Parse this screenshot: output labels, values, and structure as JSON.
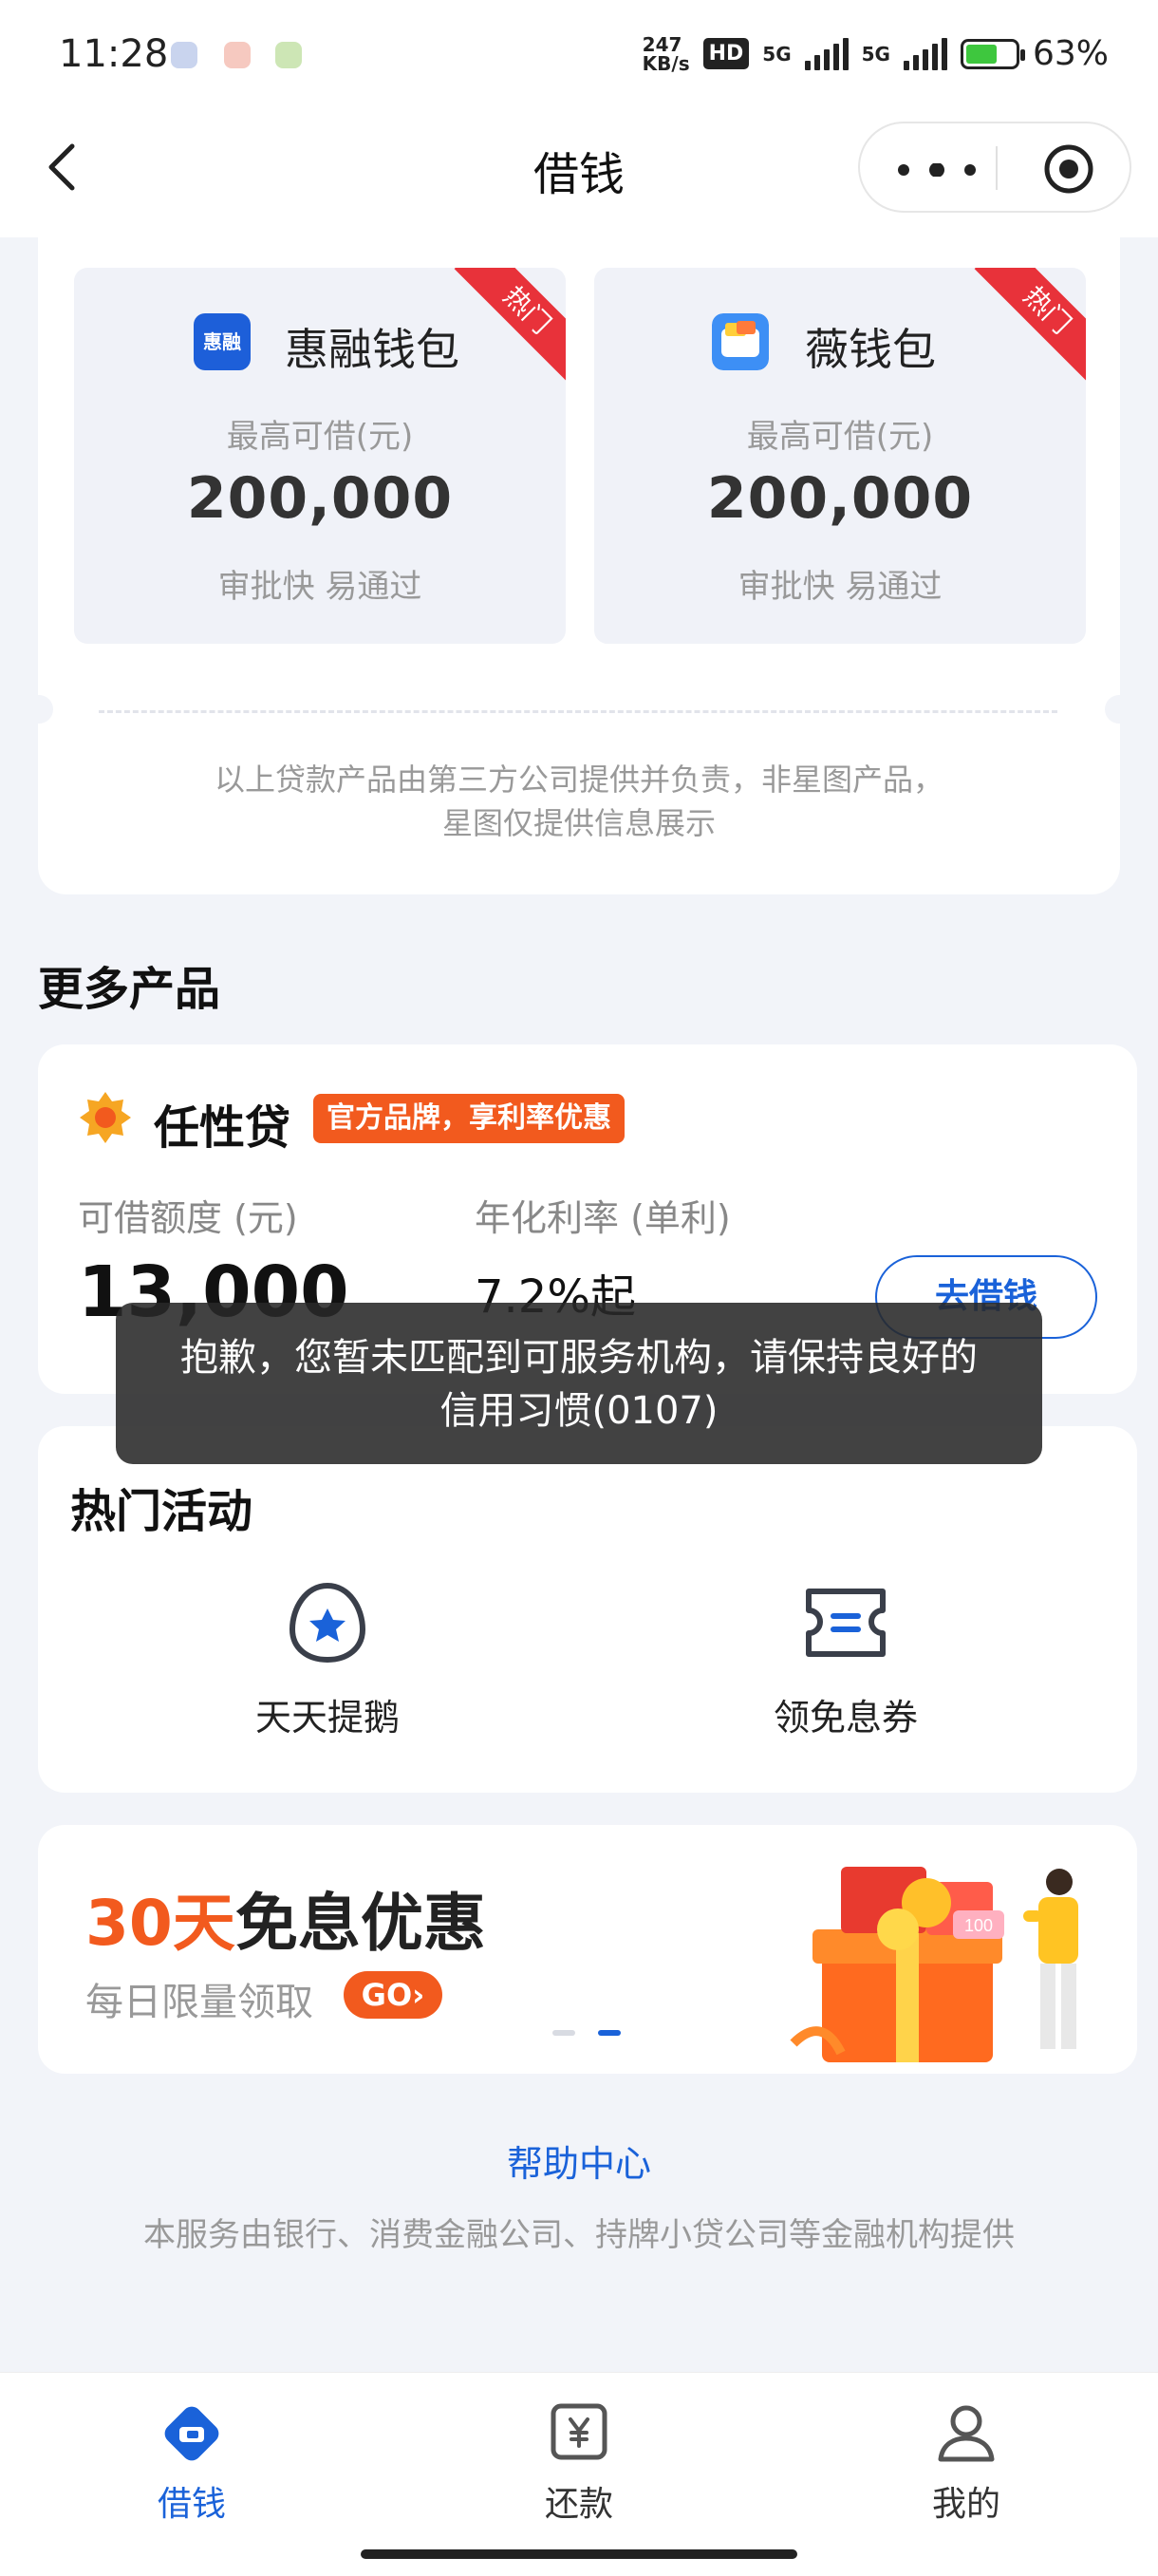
{
  "status": {
    "time": "11:28",
    "net_speed": "247",
    "net_unit": "KB/s",
    "hd": "HD",
    "sim1": "5G",
    "sim2": "5G",
    "battery": "63%",
    "battery_level": 0.63
  },
  "nav": {
    "title": "借钱"
  },
  "loan_cards": [
    {
      "name": "惠融钱包",
      "logo_text": "惠融",
      "max_label": "最高可借(元)",
      "amount": "200,000",
      "tagline": "审批快 易通过",
      "ribbon": "热门"
    },
    {
      "name": "薇钱包",
      "logo_text": "薇钱包",
      "max_label": "最高可借(元)",
      "amount": "200,000",
      "tagline": "审批快 易通过",
      "ribbon": "热门"
    }
  ],
  "disclaimer": {
    "line1": "以上贷款产品由第三方公司提供并负责，非星图产品，",
    "line2": "星图仅提供信息展示"
  },
  "more": {
    "title": "更多产品",
    "product": {
      "name": "任性贷",
      "badge": "官方品牌，享利率优惠",
      "limit_label": "可借额度 (元)",
      "limit_value": "13,000",
      "rate_label": "年化利率 (单利)",
      "rate_value": "7.2%起",
      "button": "去借钱"
    }
  },
  "toast": {
    "line1": "抱歉，您暂未匹配到可服务机构，请保持良好的",
    "line2": "信用习惯(0107)"
  },
  "hot": {
    "title": "热门活动",
    "items": [
      {
        "label": "天天提鹅",
        "icon": "penguin-star-icon"
      },
      {
        "label": "领免息券",
        "icon": "coupon-icon"
      }
    ]
  },
  "promo": {
    "title_red": "30天",
    "title_rest": "免息优惠",
    "subtitle": "每日限量领取",
    "go": "GO",
    "gift_badge": "100",
    "active_slide": 2,
    "slides": 2
  },
  "help": {
    "link": "帮助中心",
    "footer": "本服务由银行、消费金融公司、持牌小贷公司等金融机构提供"
  },
  "tabs": [
    {
      "label": "借钱",
      "active": true
    },
    {
      "label": "还款",
      "active": false
    },
    {
      "label": "我的",
      "active": false
    }
  ],
  "colors": {
    "accent": "#1a62d9",
    "orange": "#f25a1e",
    "ribbon": "#e8323a"
  }
}
